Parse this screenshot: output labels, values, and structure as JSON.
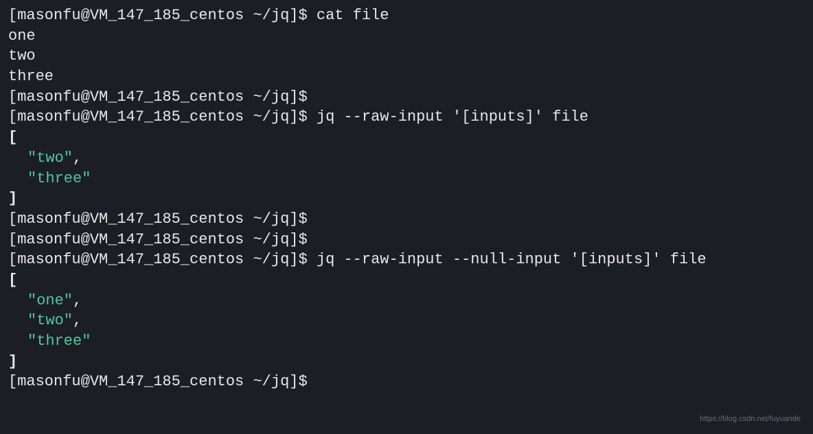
{
  "terminal": {
    "lines": [
      {
        "type": "prompt-cmd",
        "prompt": "[masonfu@VM_147_185_centos ~/jq]$ ",
        "cmd": "cat file"
      },
      {
        "type": "output",
        "text": "one"
      },
      {
        "type": "output",
        "text": "two"
      },
      {
        "type": "output",
        "text": "three"
      },
      {
        "type": "prompt-cmd",
        "prompt": "[masonfu@VM_147_185_centos ~/jq]$ ",
        "cmd": ""
      },
      {
        "type": "prompt-cmd",
        "prompt": "[masonfu@VM_147_185_centos ~/jq]$ ",
        "cmd": "jq --raw-input '[inputs]' file"
      },
      {
        "type": "bracket",
        "text": "["
      },
      {
        "type": "string-comma",
        "text": "\"two\"",
        "comma": ","
      },
      {
        "type": "string",
        "text": "\"three\""
      },
      {
        "type": "bracket",
        "text": "]"
      },
      {
        "type": "prompt-cmd",
        "prompt": "[masonfu@VM_147_185_centos ~/jq]$ ",
        "cmd": ""
      },
      {
        "type": "prompt-cmd",
        "prompt": "[masonfu@VM_147_185_centos ~/jq]$ ",
        "cmd": ""
      },
      {
        "type": "prompt-cmd",
        "prompt": "[masonfu@VM_147_185_centos ~/jq]$ ",
        "cmd": "jq --raw-input --null-input '[inputs]' file"
      },
      {
        "type": "bracket",
        "text": "["
      },
      {
        "type": "string-comma",
        "text": "\"one\"",
        "comma": ","
      },
      {
        "type": "string-comma",
        "text": "\"two\"",
        "comma": ","
      },
      {
        "type": "string",
        "text": "\"three\""
      },
      {
        "type": "bracket",
        "text": "]"
      },
      {
        "type": "prompt-cmd",
        "prompt": "[masonfu@VM_147_185_centos ~/jq]$ ",
        "cmd": ""
      }
    ]
  },
  "watermark": "https://blog.csdn.net/fuyuande"
}
